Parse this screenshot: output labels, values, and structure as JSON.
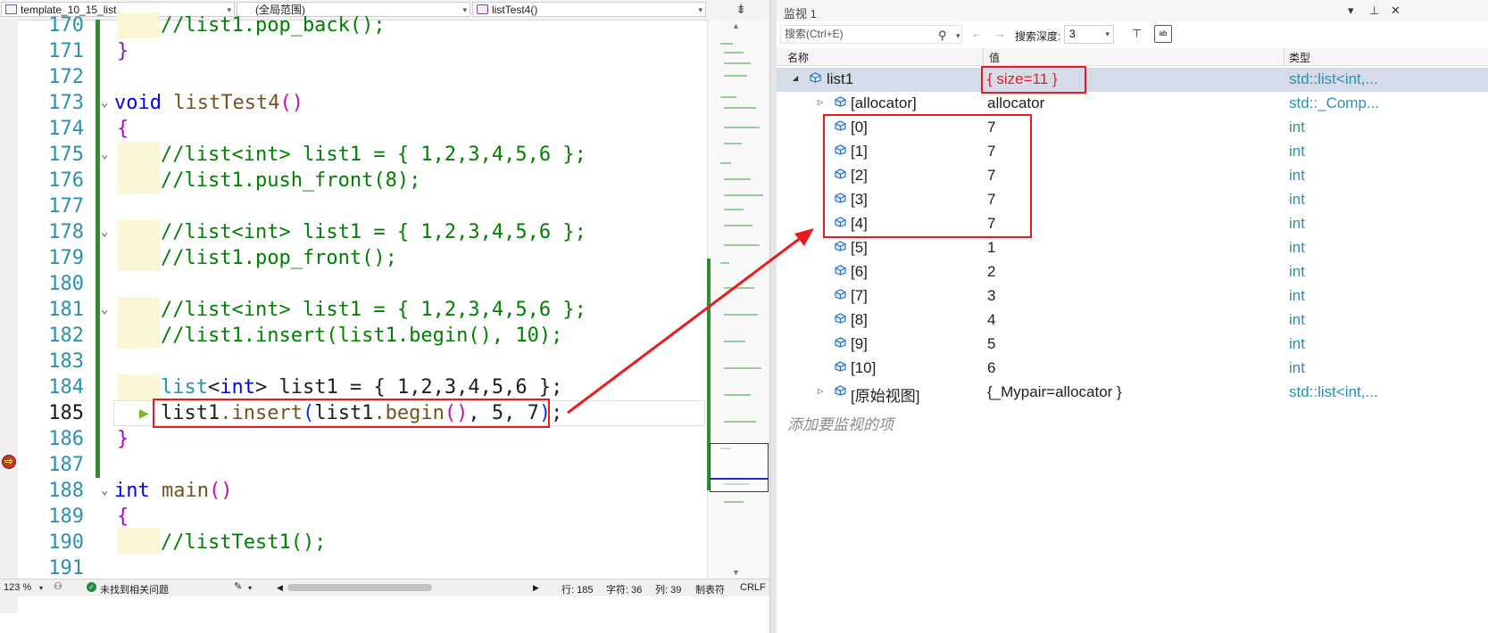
{
  "nav_bar": {
    "project": "template_10_15_list",
    "scope": "(全局范围)",
    "function": "listTest4()"
  },
  "code_lines": [
    {
      "num": "170",
      "text": "//list1.pop_back();"
    },
    {
      "num": "171",
      "text": "}"
    },
    {
      "num": "172",
      "text": ""
    },
    {
      "num": "173",
      "text": "void listTest4()"
    },
    {
      "num": "174",
      "text": "{"
    },
    {
      "num": "175",
      "text": "//list<int> list1 = { 1,2,3,4,5,6 };"
    },
    {
      "num": "176",
      "text": "//list1.push_front(8);"
    },
    {
      "num": "177",
      "text": ""
    },
    {
      "num": "178",
      "text": "//list<int> list1 = { 1,2,3,4,5,6 };"
    },
    {
      "num": "179",
      "text": "//list1.pop_front();"
    },
    {
      "num": "180",
      "text": ""
    },
    {
      "num": "181",
      "text": "//list<int> list1 = { 1,2,3,4,5,6 };"
    },
    {
      "num": "182",
      "text": "//list1.insert(list1.begin(), 10);"
    },
    {
      "num": "183",
      "text": ""
    },
    {
      "num": "184",
      "text": "list<int> list1 = { 1,2,3,4,5,6 };"
    },
    {
      "num": "185",
      "text": "list1.insert(list1.begin(), 5, 7);"
    },
    {
      "num": "186",
      "text": "}"
    },
    {
      "num": "187",
      "text": ""
    },
    {
      "num": "188",
      "text": "int main()"
    },
    {
      "num": "189",
      "text": "{"
    },
    {
      "num": "190",
      "text": "//listTest1();"
    },
    {
      "num": "191",
      "text": ""
    }
  ],
  "code_tokens": {
    "kw_void": "void",
    "fn_listTest4": "listTest4",
    "paren_open": "(",
    "paren_close": ")",
    "brace_open": "{",
    "brace_close": "}",
    "kw_int": "int",
    "fn_main": "main",
    "type_list": "list",
    "lt": "<",
    "gt": ">",
    "decl_rest": " list1 = ",
    "init_list": "{ 1,2,3,4,5,6 }",
    "semi": ";",
    "var_list1": "list1",
    "dot_insert": ".insert",
    "dot_begin": ".begin",
    "args_rest": ", 5, 7",
    "brace_main_open": "{"
  },
  "status_bar": {
    "zoom": "123 %",
    "issues": "未找到相关问题",
    "line": "行: 185",
    "char": "字符: 36",
    "col": "列: 39",
    "tabs": "制表符",
    "eol": "CRLF"
  },
  "watch": {
    "title": "监视 1",
    "search_placeholder": "搜索(Ctrl+E)",
    "depth_label": "搜索深度:",
    "depth_value": "3",
    "hex_label": "ab",
    "col_name": "名称",
    "col_value": "值",
    "col_type": "类型",
    "rows": [
      {
        "name": "list1",
        "value": "{ size=11 }",
        "type": "std::list<int,..."
      },
      {
        "name": "[allocator]",
        "value": "allocator",
        "type": "std::_Comp..."
      },
      {
        "name": "[0]",
        "value": "7",
        "type": "int"
      },
      {
        "name": "[1]",
        "value": "7",
        "type": "int"
      },
      {
        "name": "[2]",
        "value": "7",
        "type": "int"
      },
      {
        "name": "[3]",
        "value": "7",
        "type": "int"
      },
      {
        "name": "[4]",
        "value": "7",
        "type": "int"
      },
      {
        "name": "[5]",
        "value": "1",
        "type": "int"
      },
      {
        "name": "[6]",
        "value": "2",
        "type": "int"
      },
      {
        "name": "[7]",
        "value": "3",
        "type": "int"
      },
      {
        "name": "[8]",
        "value": "4",
        "type": "int"
      },
      {
        "name": "[9]",
        "value": "5",
        "type": "int"
      },
      {
        "name": "[10]",
        "value": "6",
        "type": "int"
      },
      {
        "name": "[原始视图]",
        "value": "{_Mypair=allocator }",
        "type": "std::list<int,..."
      }
    ],
    "add_watch": "添加要监视的项"
  },
  "colors": {
    "highlight_red": "#e81c1c",
    "comment_green": "#008000",
    "keyword_blue": "#0000ff",
    "type_teal": "#2b91af"
  }
}
